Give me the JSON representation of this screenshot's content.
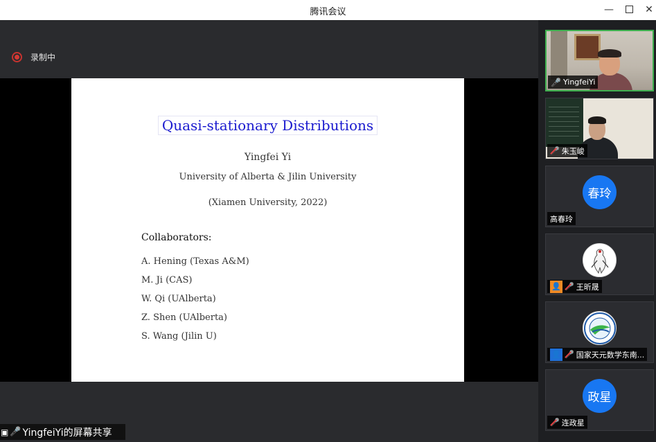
{
  "window": {
    "title": "腾讯会议",
    "minimize_label": "—",
    "close_label": "✕"
  },
  "recording": {
    "label": "录制中"
  },
  "slide": {
    "title": "Quasi-stationary Distributions",
    "author": "Yingfei Yi",
    "affiliation": "University of Alberta & Jilin University",
    "venue": "(Xiamen University, 2022)",
    "collaborators_heading": "Collaborators:",
    "collaborators": [
      "A. Hening (Texas A&M)",
      "M. Ji (CAS)",
      "W. Qi (UAlberta)",
      "Z. Shen (UAlberta)",
      "S. Wang (Jilin U)"
    ]
  },
  "share_tag": {
    "label": "YingfeiYi的屏幕共享"
  },
  "participants": [
    {
      "name": "YingfeiYi",
      "mic": "on",
      "kind": "video"
    },
    {
      "name": "朱玉峻",
      "mic": "off",
      "kind": "video"
    },
    {
      "name": "高春玲",
      "mic": "none",
      "kind": "avatar",
      "avatar_text": "春玲",
      "avatar_color": "#1877f2"
    },
    {
      "name": "王昕晟",
      "mic": "off",
      "kind": "logo"
    },
    {
      "name": "国家天元数学东南...",
      "mic": "off",
      "kind": "logo"
    },
    {
      "name": "连政星",
      "mic": "off",
      "kind": "avatar",
      "avatar_text": "政星",
      "avatar_color": "#1877f2"
    }
  ],
  "colors": {
    "accent_green": "#3fb04f",
    "record_red": "#d33a35",
    "avatar_blue": "#1877f2",
    "slide_title_blue": "#1a1acf"
  }
}
